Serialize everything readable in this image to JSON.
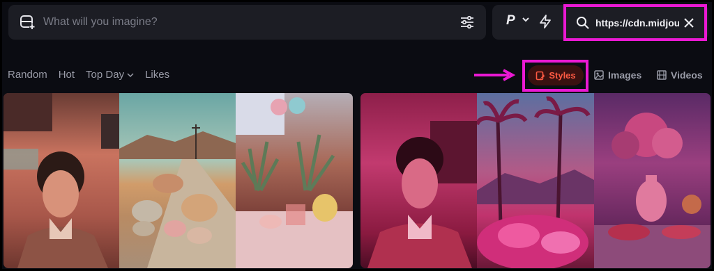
{
  "prompt": {
    "placeholder": "What will you imagine?"
  },
  "controls": {
    "personalize_label": "P"
  },
  "search": {
    "value": "https://cdn.midjou"
  },
  "filters": [
    "Random",
    "Hot",
    "Top Day",
    "Likes"
  ],
  "tabs": {
    "styles": "Styles",
    "images": "Images",
    "videos": "Videos"
  },
  "colors": {
    "highlight": "#ea19d3",
    "accent": "#ff5a43"
  },
  "gallery": [
    {
      "panels": [
        "portrait-warm",
        "desert-road",
        "plants-table"
      ]
    },
    {
      "panels": [
        "portrait-magenta",
        "palms-dusk",
        "flowers-still-life"
      ]
    }
  ]
}
